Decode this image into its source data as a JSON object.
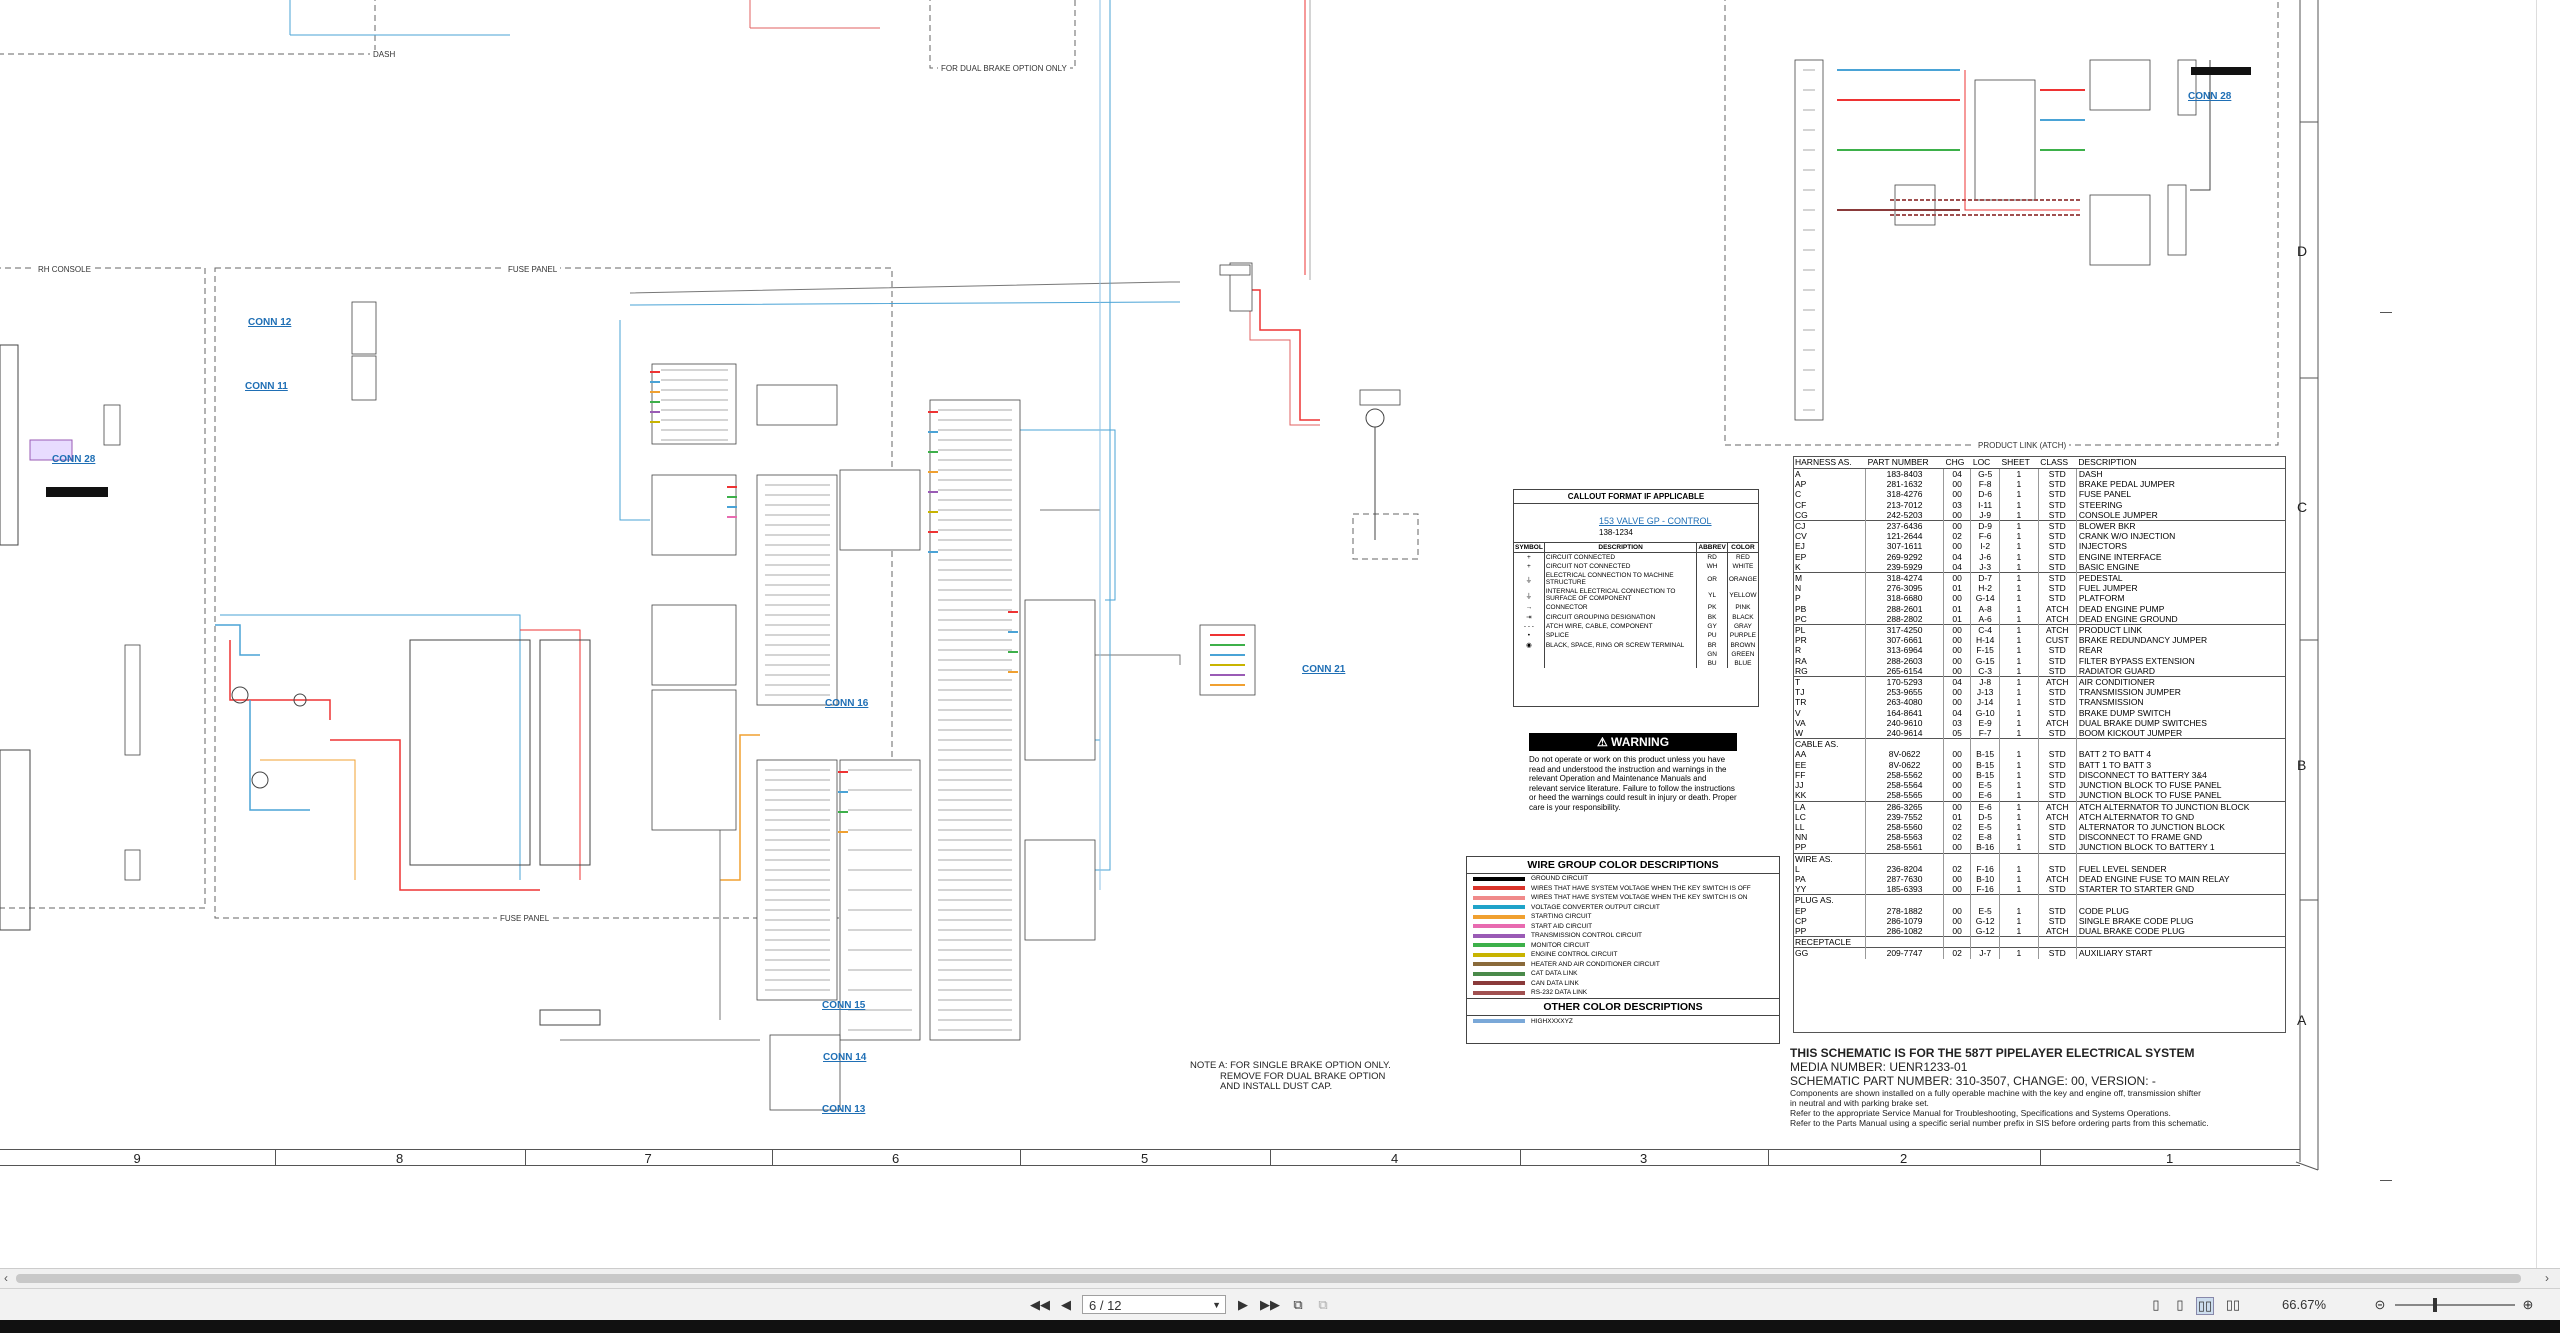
{
  "sections": {
    "dash": "DASH",
    "rh_console": "RH CONSOLE",
    "fuse_panel_top": "FUSE PANEL",
    "fuse_panel_bottom": "FUSE PANEL",
    "dual_brake": "FOR DUAL BRAKE OPTION ONLY",
    "product_link": "PRODUCT LINK (ATCH)"
  },
  "connectors": [
    "CONN 12",
    "CONN 11",
    "CONN 28",
    "CONN 16",
    "CONN 15",
    "CONN 14",
    "CONN 13",
    "CONN 21",
    "CONN 28"
  ],
  "callout": {
    "title": "CALLOUT FORMAT IF APPLICABLE",
    "example": "153 VALVE GP - CONTROL",
    "example_part": "138-1234",
    "headers": [
      "SYMBOL",
      "DESCRIPTION",
      "ABBREV",
      "COLOR"
    ],
    "rows": [
      [
        "CIRCUIT CONNECTED",
        "RD",
        "RED"
      ],
      [
        "CIRCUIT NOT CONNECTED",
        "WH",
        "WHITE"
      ],
      [
        "ELECTRICAL CONNECTION TO MACHINE STRUCTURE",
        "OR",
        "ORANGE"
      ],
      [
        "INTERNAL ELECTRICAL CONNECTION TO SURFACE OF COMPONENT",
        "YL",
        "YELLOW"
      ],
      [
        "CONNECTOR",
        "PK",
        "PINK"
      ],
      [
        "CIRCUIT GROUPING DESIGNATION",
        "BK",
        "BLACK"
      ],
      [
        "ATCH WIRE, CABLE, COMPONENT",
        "GY",
        "GRAY"
      ],
      [
        "SPLICE",
        "PU",
        "PURPLE"
      ],
      [
        "BLACK, SPACE, RING OR SCREW TERMINAL",
        "BR",
        "BROWN"
      ],
      [
        "",
        "GN",
        "GREEN"
      ],
      [
        "",
        "BU",
        "BLUE"
      ]
    ]
  },
  "warning": {
    "title": "WARNING",
    "text": "Do not operate or work on this product unless you have read and understood the instruction and warnings in the relevant Operation and Maintenance Manuals and relevant service literature. Failure to follow the instructions or heed the warnings could result in injury or death. Proper care is your responsibility."
  },
  "wire_group": {
    "title": "WIRE GROUP COLOR DESCRIPTIONS",
    "items": [
      {
        "color": "#000000",
        "label": "GROUND CIRCUIT"
      },
      {
        "color": "#d9342b",
        "label": "WIRES THAT HAVE SYSTEM VOLTAGE WHEN THE KEY SWITCH IS OFF"
      },
      {
        "color": "#f08a8a",
        "label": "WIRES THAT HAVE SYSTEM VOLTAGE WHEN THE KEY SWITCH IS ON"
      },
      {
        "color": "#1fa3c9",
        "label": "VOLTAGE CONVERTER OUTPUT CIRCUIT"
      },
      {
        "color": "#f0a030",
        "label": "STARTING CIRCUIT"
      },
      {
        "color": "#e86bb0",
        "label": "START AID CIRCUIT"
      },
      {
        "color": "#9a5bb5",
        "label": "TRANSMISSION CONTROL CIRCUIT"
      },
      {
        "color": "#3db04a",
        "label": "MONITOR CIRCUIT"
      },
      {
        "color": "#c8b400",
        "label": "ENGINE CONTROL CIRCUIT"
      },
      {
        "color": "#8a6a3a",
        "label": "HEATER AND AIR CONDITIONER CIRCUIT"
      },
      {
        "color": "#4a8a4a",
        "label": "CAT DATA LINK"
      },
      {
        "color": "#8a3a3a",
        "label": "CAN DATA LINK"
      },
      {
        "color": "#a05050",
        "label": "RS-232 DATA LINK"
      }
    ],
    "other_title": "OTHER COLOR DESCRIPTIONS",
    "other_items": [
      {
        "color": "#7aa8d8",
        "label": "HIGHXXXXYZ"
      }
    ]
  },
  "harness": {
    "headers": [
      "HARNESS AS.",
      "PART NUMBER",
      "CHG",
      "LOC",
      "SHEET",
      "CLASS",
      "DESCRIPTION"
    ],
    "rows": [
      [
        "A",
        "183-8403",
        "04",
        "G-5",
        "1",
        "STD",
        "DASH"
      ],
      [
        "AP",
        "281-1632",
        "00",
        "F-8",
        "1",
        "STD",
        "BRAKE PEDAL JUMPER"
      ],
      [
        "C",
        "318-4276",
        "00",
        "D-6",
        "1",
        "STD",
        "FUSE PANEL"
      ],
      [
        "CF",
        "213-7012",
        "03",
        "I-11",
        "1",
        "STD",
        "STEERING"
      ],
      [
        "CG",
        "242-5203",
        "00",
        "J-9",
        "1",
        "STD",
        "CONSOLE JUMPER"
      ],
      [
        "CJ",
        "237-6436",
        "00",
        "D-9",
        "1",
        "STD",
        "BLOWER BKR"
      ],
      [
        "CV",
        "121-2644",
        "02",
        "F-6",
        "1",
        "STD",
        "CRANK W/O INJECTION"
      ],
      [
        "EJ",
        "307-1611",
        "00",
        "I-2",
        "1",
        "STD",
        "INJECTORS"
      ],
      [
        "EP",
        "269-9292",
        "04",
        "J-6",
        "1",
        "STD",
        "ENGINE INTERFACE"
      ],
      [
        "K",
        "239-5929",
        "04",
        "J-3",
        "1",
        "STD",
        "BASIC ENGINE"
      ],
      [
        "M",
        "318-4274",
        "00",
        "D-7",
        "1",
        "STD",
        "PEDESTAL"
      ],
      [
        "N",
        "276-3095",
        "01",
        "H-2",
        "1",
        "STD",
        "FUEL JUMPER"
      ],
      [
        "P",
        "318-6680",
        "00",
        "G-14",
        "1",
        "STD",
        "PLATFORM"
      ],
      [
        "PB",
        "288-2601",
        "01",
        "A-8",
        "1",
        "ATCH",
        "DEAD ENGINE PUMP"
      ],
      [
        "PC",
        "288-2802",
        "01",
        "A-6",
        "1",
        "ATCH",
        "DEAD ENGINE GROUND"
      ],
      [
        "PL",
        "317-4250",
        "00",
        "C-4",
        "1",
        "ATCH",
        "PRODUCT LINK"
      ],
      [
        "PR",
        "307-6661",
        "00",
        "H-14",
        "1",
        "CUST",
        "BRAKE REDUNDANCY JUMPER"
      ],
      [
        "R",
        "313-6964",
        "00",
        "F-15",
        "1",
        "STD",
        "REAR"
      ],
      [
        "RA",
        "288-2603",
        "00",
        "G-15",
        "1",
        "STD",
        "FILTER BYPASS EXTENSION"
      ],
      [
        "RG",
        "265-6154",
        "00",
        "C-3",
        "1",
        "STD",
        "RADIATOR GUARD"
      ],
      [
        "T",
        "170-5293",
        "04",
        "J-8",
        "1",
        "ATCH",
        "AIR CONDITIONER"
      ],
      [
        "TJ",
        "253-9655",
        "00",
        "J-13",
        "1",
        "STD",
        "TRANSMISSION JUMPER"
      ],
      [
        "TR",
        "263-4080",
        "00",
        "J-14",
        "1",
        "STD",
        "TRANSMISSION"
      ],
      [
        "V",
        "164-8641",
        "04",
        "G-10",
        "1",
        "STD",
        "BRAKE DUMP SWITCH"
      ],
      [
        "VA",
        "240-9610",
        "03",
        "E-9",
        "1",
        "ATCH",
        "DUAL BRAKE DUMP SWITCHES"
      ],
      [
        "W",
        "240-9614",
        "05",
        "F-7",
        "1",
        "STD",
        "BOOM KICKOUT JUMPER"
      ],
      [
        "CABLE AS.",
        "",
        "",
        "",
        "",
        "",
        ""
      ],
      [
        "AA",
        "8V-0622",
        "00",
        "B-15",
        "1",
        "STD",
        "BATT 2 TO BATT 4"
      ],
      [
        "EE",
        "8V-0622",
        "00",
        "B-15",
        "1",
        "STD",
        "BATT 1 TO BATT 3"
      ],
      [
        "FF",
        "258-5562",
        "00",
        "B-15",
        "1",
        "STD",
        "DISCONNECT TO BATTERY 3&4"
      ],
      [
        "JJ",
        "258-5564",
        "00",
        "E-5",
        "1",
        "STD",
        "JUNCTION BLOCK TO FUSE PANEL"
      ],
      [
        "KK",
        "258-5565",
        "00",
        "E-6",
        "1",
        "STD",
        "JUNCTION BLOCK TO FUSE PANEL"
      ],
      [
        "LA",
        "286-3265",
        "00",
        "E-6",
        "1",
        "ATCH",
        "ATCH ALTERNATOR TO JUNCTION BLOCK"
      ],
      [
        "LC",
        "239-7552",
        "01",
        "D-5",
        "1",
        "ATCH",
        "ATCH ALTERNATOR TO GND"
      ],
      [
        "LL",
        "258-5560",
        "02",
        "E-5",
        "1",
        "STD",
        "ALTERNATOR TO JUNCTION BLOCK"
      ],
      [
        "NN",
        "258-5563",
        "02",
        "E-8",
        "1",
        "STD",
        "DISCONNECT TO FRAME GND"
      ],
      [
        "PP",
        "258-5561",
        "00",
        "B-16",
        "1",
        "STD",
        "JUNCTION BLOCK TO BATTERY 1"
      ],
      [
        "WIRE AS.",
        "",
        "",
        "",
        "",
        "",
        ""
      ],
      [
        "L",
        "236-8204",
        "02",
        "F-16",
        "1",
        "STD",
        "FUEL LEVEL SENDER"
      ],
      [
        "PA",
        "287-7630",
        "00",
        "B-10",
        "1",
        "ATCH",
        "DEAD ENGINE FUSE TO MAIN RELAY"
      ],
      [
        "YY",
        "185-6393",
        "00",
        "F-16",
        "1",
        "STD",
        "STARTER TO STARTER GND"
      ],
      [
        "PLUG AS.",
        "",
        "",
        "",
        "",
        "",
        ""
      ],
      [
        "EP",
        "278-1882",
        "00",
        "E-5",
        "1",
        "STD",
        "CODE PLUG"
      ],
      [
        "CP",
        "286-1079",
        "00",
        "G-12",
        "1",
        "STD",
        "SINGLE BRAKE CODE PLUG"
      ],
      [
        "PP",
        "286-1082",
        "00",
        "G-12",
        "1",
        "ATCH",
        "DUAL BRAKE CODE PLUG"
      ],
      [
        "RECEPTACLE",
        "",
        "",
        "",
        "",
        "",
        ""
      ],
      [
        "GG",
        "209-7747",
        "02",
        "J-7",
        "1",
        "STD",
        "AUXILIARY START"
      ]
    ]
  },
  "note": {
    "line1": "NOTE A:  FOR SINGLE BRAKE OPTION ONLY.",
    "line2": "REMOVE FOR DUAL BRAKE OPTION",
    "line3": "AND INSTALL DUST CAP."
  },
  "titleblock": {
    "line1": "THIS SCHEMATIC IS FOR THE 587T PIPELAYER ELECTRICAL SYSTEM",
    "line2": "MEDIA NUMBER: UENR1233-01",
    "line3": "SCHEMATIC PART NUMBER: 310-3507, CHANGE: 00, VERSION: -",
    "line4": "Components are shown installed on a fully operable machine with the key and engine off, transmission shifter",
    "line5": "in neutral and with parking brake set.",
    "line6": "Refer to the appropriate Service Manual for Troubleshooting, Specifications and Systems Operations.",
    "line7": "Refer to the Parts Manual using a specific serial number prefix in SIS before ordering parts from this schematic."
  },
  "grid": {
    "columns": [
      "9",
      "8",
      "7",
      "6",
      "5",
      "4",
      "3",
      "2",
      "1"
    ],
    "rows": [
      "D",
      "C",
      "B",
      "A"
    ]
  },
  "statusbar": {
    "page": "6 / 12",
    "zoom": "66.67%"
  }
}
